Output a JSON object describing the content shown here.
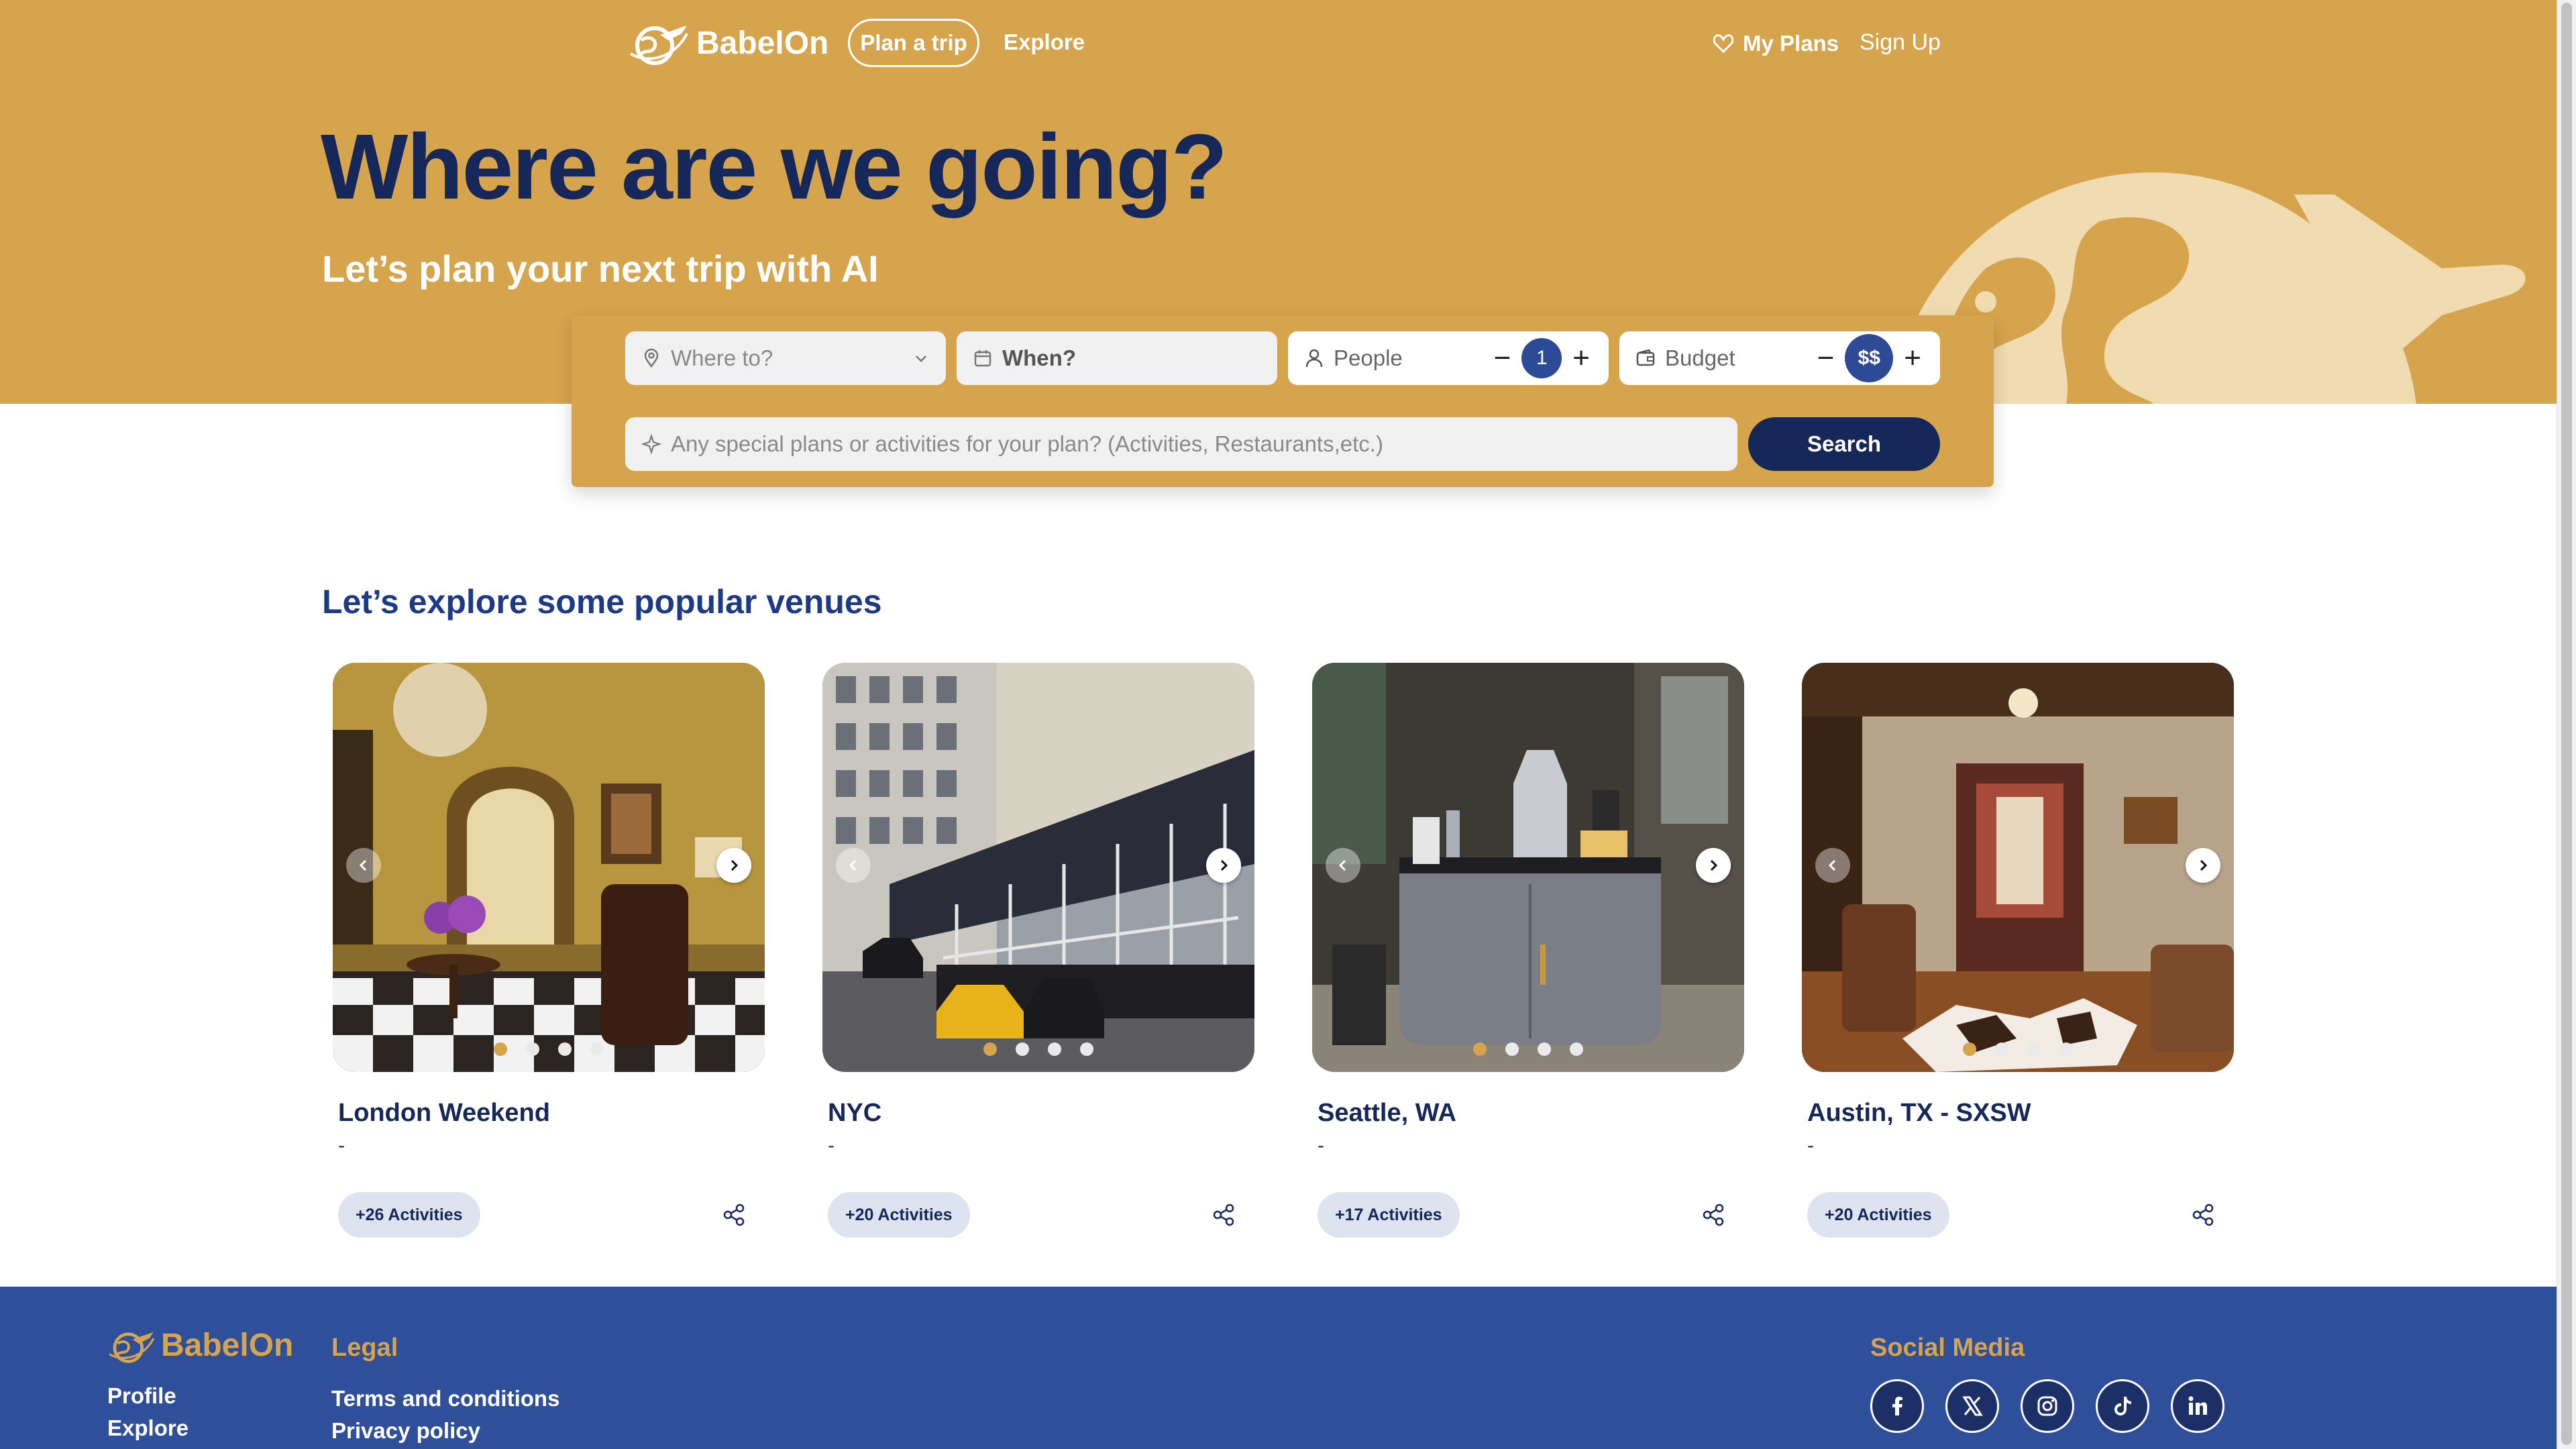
{
  "header": {
    "brand": "BabelOn",
    "plan_trip": "Plan a trip",
    "explore": "Explore",
    "my_plans": "My Plans",
    "sign_up": "Sign Up"
  },
  "hero": {
    "title": "Where are we going?",
    "subtitle": "Let’s plan your next trip with AI"
  },
  "search": {
    "where_placeholder": "Where to?",
    "when_placeholder": "When?",
    "people_label": "People",
    "people_value": "1",
    "budget_label": "Budget",
    "budget_value": "$$",
    "special_placeholder": "Any special plans or activities for your plan? (Activities, Restaurants,etc.)",
    "button": "Search"
  },
  "venues": {
    "title": "Let’s explore some popular venues",
    "cards": [
      {
        "name": "London Weekend",
        "subtitle": "-",
        "activities": "+26 Activities",
        "slide": 1,
        "slide_count": 4
      },
      {
        "name": "NYC",
        "subtitle": "-",
        "activities": "+20 Activities",
        "slide": 1,
        "slide_count": 4
      },
      {
        "name": "Seattle, WA",
        "subtitle": "-",
        "activities": "+17 Activities",
        "slide": 1,
        "slide_count": 4
      },
      {
        "name": "Austin, TX - SXSW",
        "subtitle": "-",
        "activities": "+20 Activities",
        "slide": 1,
        "slide_count": 4
      }
    ]
  },
  "footer": {
    "brand": "BabelOn",
    "links": [
      "Profile",
      "Explore"
    ],
    "legal_heading": "Legal",
    "legal_links": [
      "Terms and conditions",
      "Privacy policy"
    ],
    "social_heading": "Social Media",
    "social_icons": [
      "facebook-icon",
      "x-icon",
      "instagram-icon",
      "tiktok-icon",
      "linkedin-icon"
    ]
  },
  "colors": {
    "gold": "#d6a44c",
    "navy": "#16275a",
    "footer_blue": "#2f4f9a",
    "accent_blue": "#2c4a95"
  }
}
